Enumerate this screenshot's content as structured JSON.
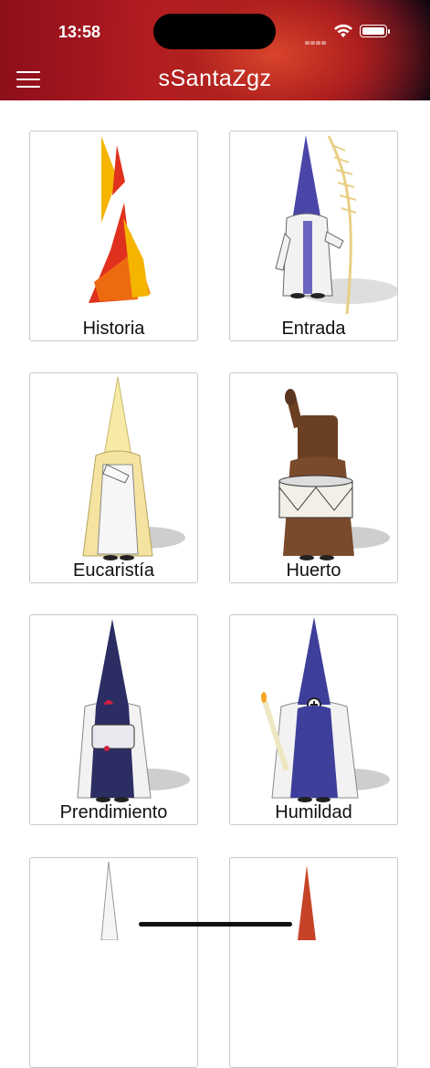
{
  "status_bar": {
    "time": "13:58"
  },
  "header": {
    "title": "sSantaZgz",
    "menu_icon": "hamburger-menu-icon"
  },
  "colors": {
    "header_red": "#b81c22",
    "header_dark": "#0b0610",
    "card_border": "#c9c9c9"
  },
  "items": [
    {
      "label": "Historia",
      "icon": "historia-logo"
    },
    {
      "label": "Entrada",
      "icon": "nazareno-purple-white"
    },
    {
      "label": "Eucaristía",
      "icon": "nazareno-cream"
    },
    {
      "label": "Huerto",
      "icon": "nazareno-brown-drum"
    },
    {
      "label": "Prendimiento",
      "icon": "nazareno-navy-drum"
    },
    {
      "label": "Humildad",
      "icon": "nazareno-blue-candle"
    },
    {
      "label": "",
      "icon": "nazareno-white"
    },
    {
      "label": "",
      "icon": "nazareno-red"
    }
  ]
}
